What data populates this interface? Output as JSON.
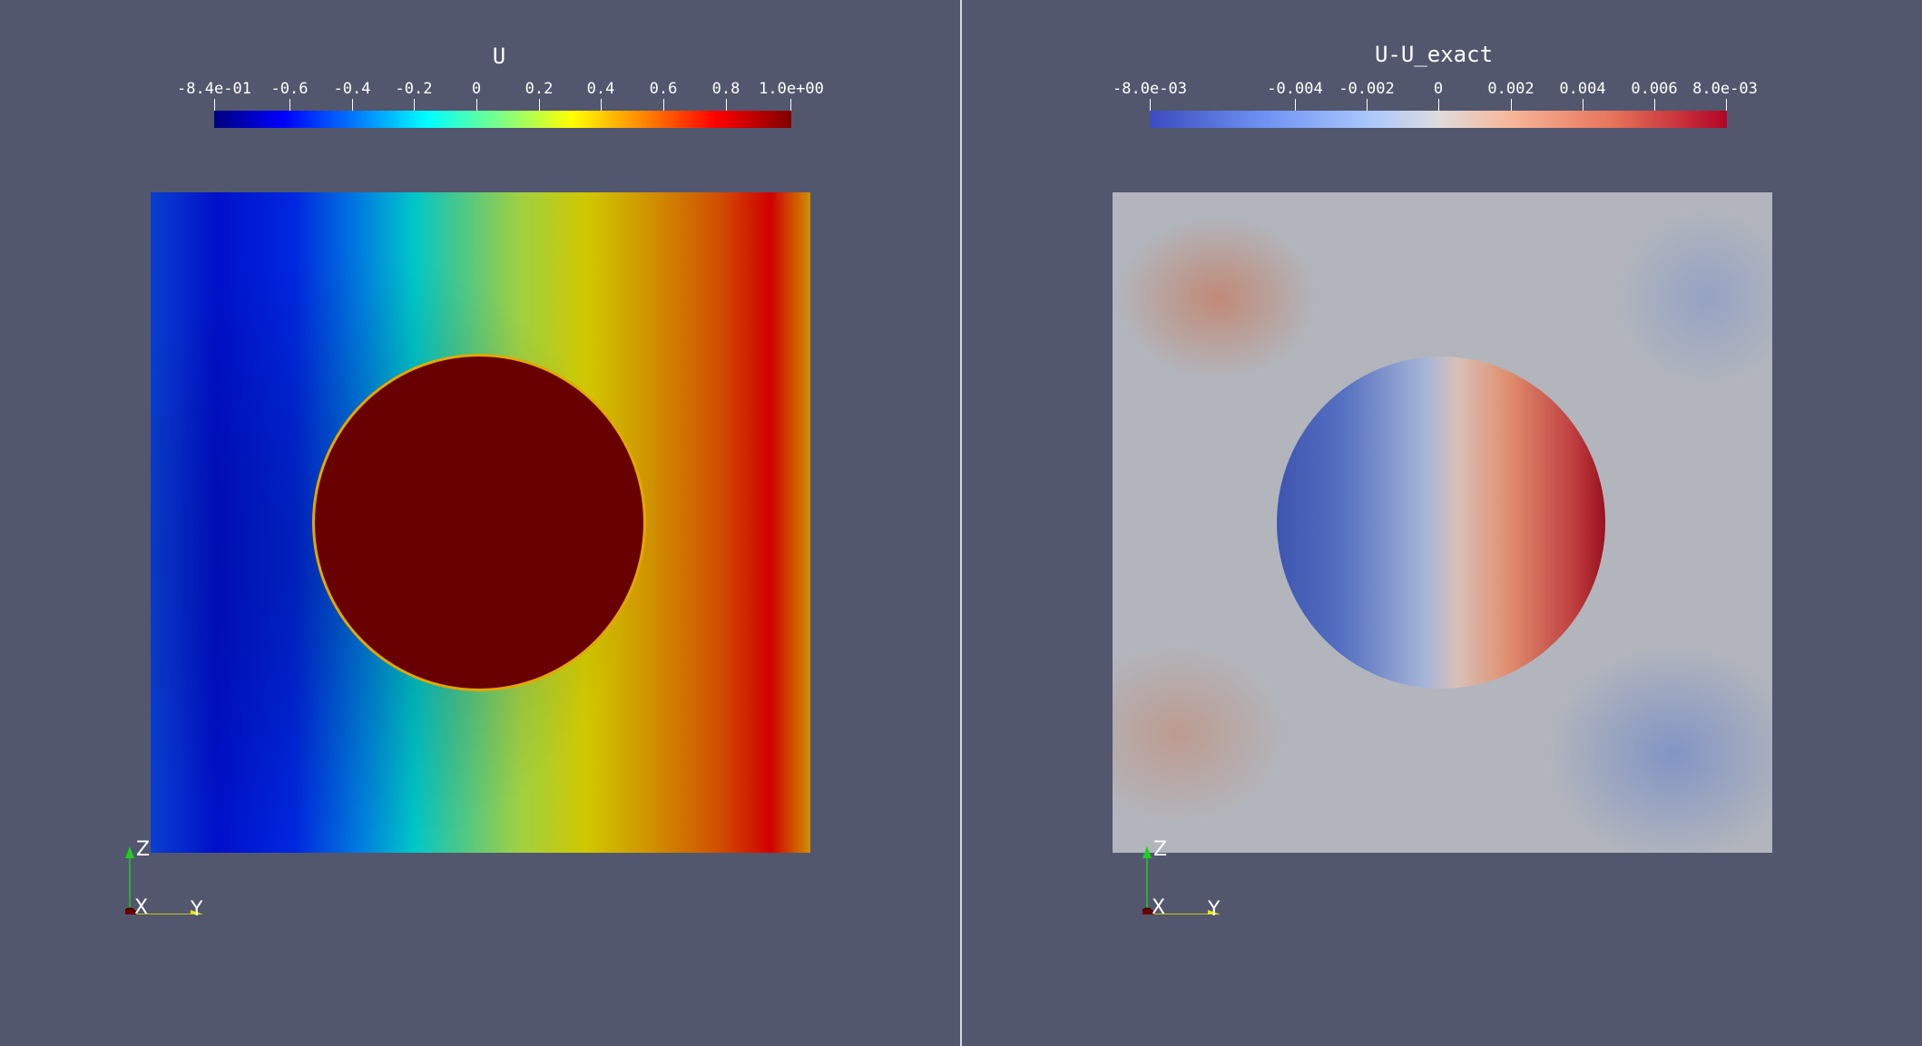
{
  "views": [
    {
      "title": "U",
      "colorbar": {
        "tick_labels": [
          "-8.4e-01",
          "-0.6",
          "-0.4",
          "-0.2",
          "0",
          "0.2",
          "0.4",
          "0.6",
          "0.8",
          "1.0e+00"
        ],
        "range": [
          -0.84,
          1.0
        ],
        "colormap": "jet"
      },
      "axes": {
        "labels": [
          "Z",
          "X",
          "Y"
        ]
      }
    },
    {
      "title": "U-U_exact",
      "colorbar": {
        "tick_labels": [
          "-8.0e-03",
          "-0.004",
          "-0.002",
          "0",
          "0.002",
          "0.004",
          "0.006",
          "8.0e-03"
        ],
        "range": [
          -0.008,
          0.008
        ],
        "colormap": "coolwarm"
      },
      "axes": {
        "labels": [
          "Z",
          "X",
          "Y"
        ]
      }
    }
  ],
  "colors": {
    "background": "#52576e",
    "circle_value_color": "#680000"
  }
}
